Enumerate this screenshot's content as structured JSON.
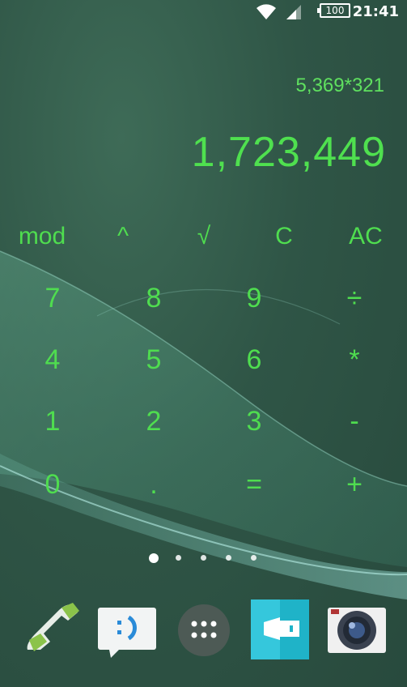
{
  "status_bar": {
    "time": "21:41",
    "battery": "100",
    "icons": [
      "wifi-icon",
      "signal-icon",
      "battery-icon"
    ]
  },
  "calculator": {
    "expression": "5,369*321",
    "result": "1,723,449",
    "function_keys": [
      "mod",
      "^",
      "√",
      "C",
      "AC"
    ],
    "keypad": [
      [
        "7",
        "8",
        "9",
        "÷"
      ],
      [
        "4",
        "5",
        "6",
        "*"
      ],
      [
        "1",
        "2",
        "3",
        "-"
      ],
      [
        "0",
        ".",
        "=",
        "+"
      ]
    ],
    "text_color": "#4fdd4f"
  },
  "home": {
    "page_count": 5,
    "active_page": 1
  },
  "dock": {
    "apps": [
      "phone-icon",
      "messaging-icon",
      "app-drawer-icon",
      "album-icon",
      "camera-icon"
    ]
  },
  "colors": {
    "background": "#2f5546",
    "accent_green": "#4fdd4f"
  }
}
